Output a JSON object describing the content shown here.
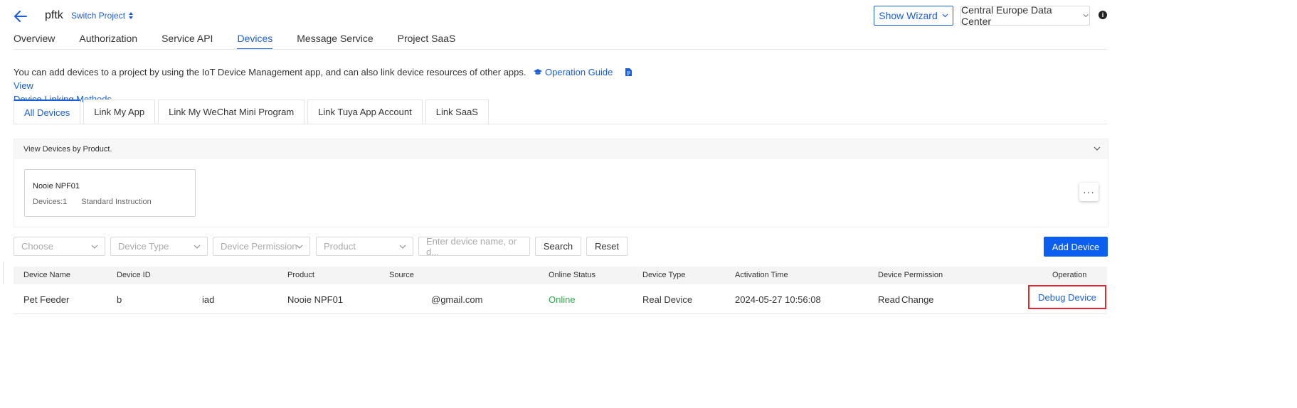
{
  "header": {
    "project_name": "pftk",
    "switch_label": "Switch Project",
    "wizard_label": "Show Wizard",
    "region_label": "Central Europe Data Center"
  },
  "nav": {
    "tabs": [
      {
        "label": "Overview",
        "active": false
      },
      {
        "label": "Authorization",
        "active": false
      },
      {
        "label": "Service API",
        "active": false
      },
      {
        "label": "Devices",
        "active": true
      },
      {
        "label": "Message Service",
        "active": false
      },
      {
        "label": "Project SaaS",
        "active": false
      }
    ]
  },
  "intro": {
    "text": "You can add devices to a project by using the IoT Device Management app, and can also link device resources of other apps.",
    "guide_link": "Operation Guide",
    "view_link": "View",
    "methods_link": "Device Linking Methods"
  },
  "subtabs": [
    "All Devices",
    "Link My App",
    "Link My WeChat Mini Program",
    "Link Tuya App Account",
    "Link SaaS"
  ],
  "panel": {
    "title": "View Devices by Product.",
    "card": {
      "name": "Nooie NPF01",
      "devices": "Devices:1",
      "type": "Standard Instruction"
    }
  },
  "filters": {
    "choose": "Choose",
    "device_type": "Device Type",
    "device_permission": "Device Permission",
    "product": "Product",
    "search_placeholder": "Enter device name, or d...",
    "search_label": "Search",
    "reset_label": "Reset",
    "add_label": "Add Device"
  },
  "table": {
    "headers": {
      "name": "Device Name",
      "id": "Device ID",
      "product": "Product",
      "source": "Source",
      "status": "Online Status",
      "type": "Device Type",
      "activation": "Activation Time",
      "permission": "Device Permission",
      "operation": "Operation"
    },
    "row": {
      "name": "Pet Feeder",
      "id_a": "b",
      "id_b": "iad",
      "product": "Nooie NPF01",
      "source": "@gmail.com",
      "status": "Online",
      "type": "Real Device",
      "activation": "2024-05-27 10:56:08",
      "permission": "Read",
      "change": "Change",
      "debug": "Debug Device"
    }
  },
  "colors": {
    "accent": "#1a5fd6",
    "primary_button": "#0b5ef0",
    "online": "#2eaa4a",
    "highlight": "#e3262f"
  }
}
